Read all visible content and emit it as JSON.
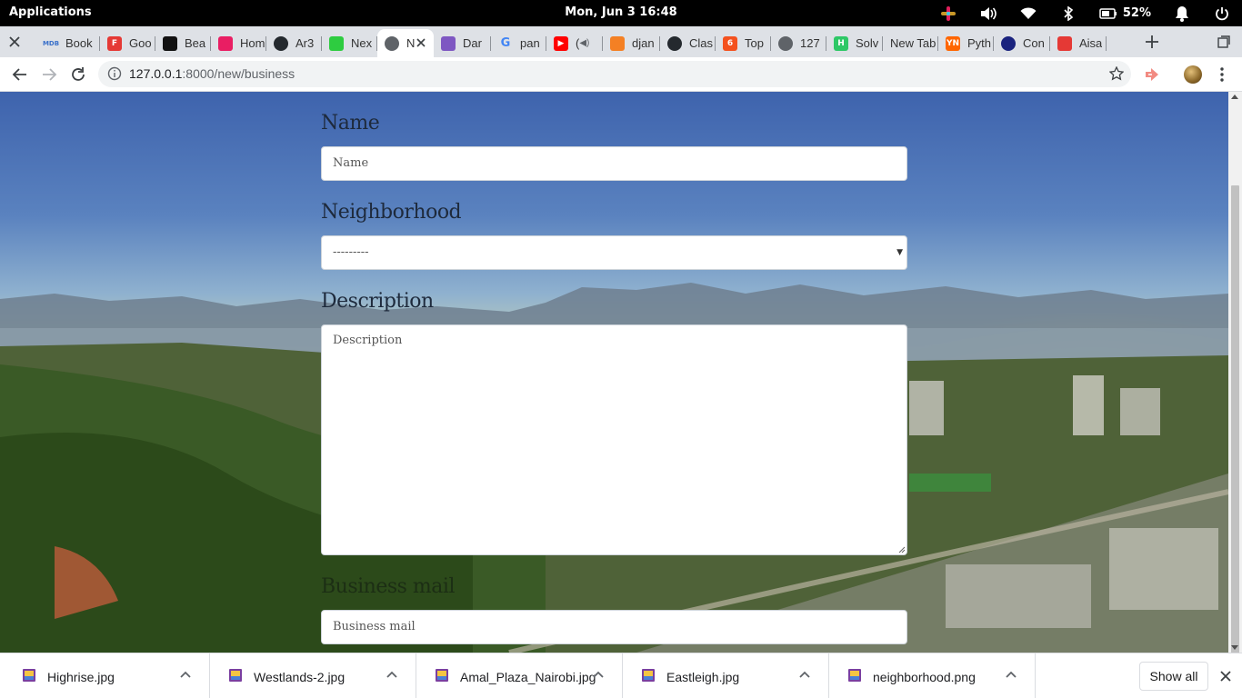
{
  "topbar": {
    "activities_label": "Applications",
    "clock": "Mon, Jun 3   16:48",
    "battery_percent": "52%",
    "icons": [
      "slack-icon",
      "volume-icon",
      "wifi-icon",
      "bluetooth-icon",
      "battery-icon",
      "notification-bell-icon",
      "power-icon"
    ]
  },
  "tabs": [
    {
      "title": "Book",
      "favicon": "mdb-icon",
      "color": "#3b71ca",
      "glyph": "MDB"
    },
    {
      "title": "Goo",
      "favicon": "f-icon",
      "color": "#e53935",
      "glyph": "F"
    },
    {
      "title": "Bea",
      "favicon": "behance-icon",
      "color": "#111111",
      "glyph": ""
    },
    {
      "title": "Hom",
      "favicon": "home-icon",
      "color": "#e91e63",
      "glyph": ""
    },
    {
      "title": "Ar3",
      "favicon": "github-icon",
      "color": "#24292e",
      "glyph": ""
    },
    {
      "title": "Nex",
      "favicon": "nexus-icon",
      "color": "#2ecc40",
      "glyph": ""
    },
    {
      "title": "N",
      "favicon": "globe-icon",
      "color": "#5f6368",
      "glyph": "",
      "active": true
    },
    {
      "title": "Dar",
      "favicon": "hexagon-icon",
      "color": "#7e57c2",
      "glyph": ""
    },
    {
      "title": "pan",
      "favicon": "google-icon",
      "color": "#4285f4",
      "glyph": "G"
    },
    {
      "title": "(",
      "favicon": "youtube-icon",
      "color": "#ff0000",
      "glyph": "▶",
      "audio": true
    },
    {
      "title": "djan",
      "favicon": "stackoverflow-icon",
      "color": "#f48024",
      "glyph": ""
    },
    {
      "title": "Clas",
      "favicon": "github-icon",
      "color": "#24292e",
      "glyph": ""
    },
    {
      "title": "Top",
      "favicon": "orange-circle-icon",
      "color": "#f4511e",
      "glyph": "6"
    },
    {
      "title": "127",
      "favicon": "globe-icon",
      "color": "#5f6368",
      "glyph": ""
    },
    {
      "title": "Solv",
      "favicon": "hackerrank-icon",
      "color": "#2ec866",
      "glyph": "H"
    },
    {
      "title": "New Tab",
      "favicon": "",
      "color": "",
      "glyph": ""
    },
    {
      "title": "Pyth",
      "favicon": "yn-icon",
      "color": "#ff6600",
      "glyph": "YN"
    },
    {
      "title": "Con",
      "favicon": "openshift-icon",
      "color": "#1a237e",
      "glyph": ""
    },
    {
      "title": "Aisa",
      "favicon": "asana-icon",
      "color": "#e53935",
      "glyph": ""
    }
  ],
  "toolbar": {
    "url_host": "127.0.0.1",
    "url_path": ":8000/new/business"
  },
  "form": {
    "name_label": "Name",
    "name_placeholder": "Name",
    "neighborhood_label": "Neighborhood",
    "neighborhood_value": "---------",
    "description_label": "Description",
    "description_placeholder": "Description",
    "email_label": "Business mail",
    "email_placeholder": "Business mail"
  },
  "downloads": {
    "items": [
      "Highrise.jpg",
      "Westlands-2.jpg",
      "Amal_Plaza_Nairobi.jpg",
      "Eastleigh.jpg",
      "neighborhood.png"
    ],
    "show_all_label": "Show all"
  }
}
